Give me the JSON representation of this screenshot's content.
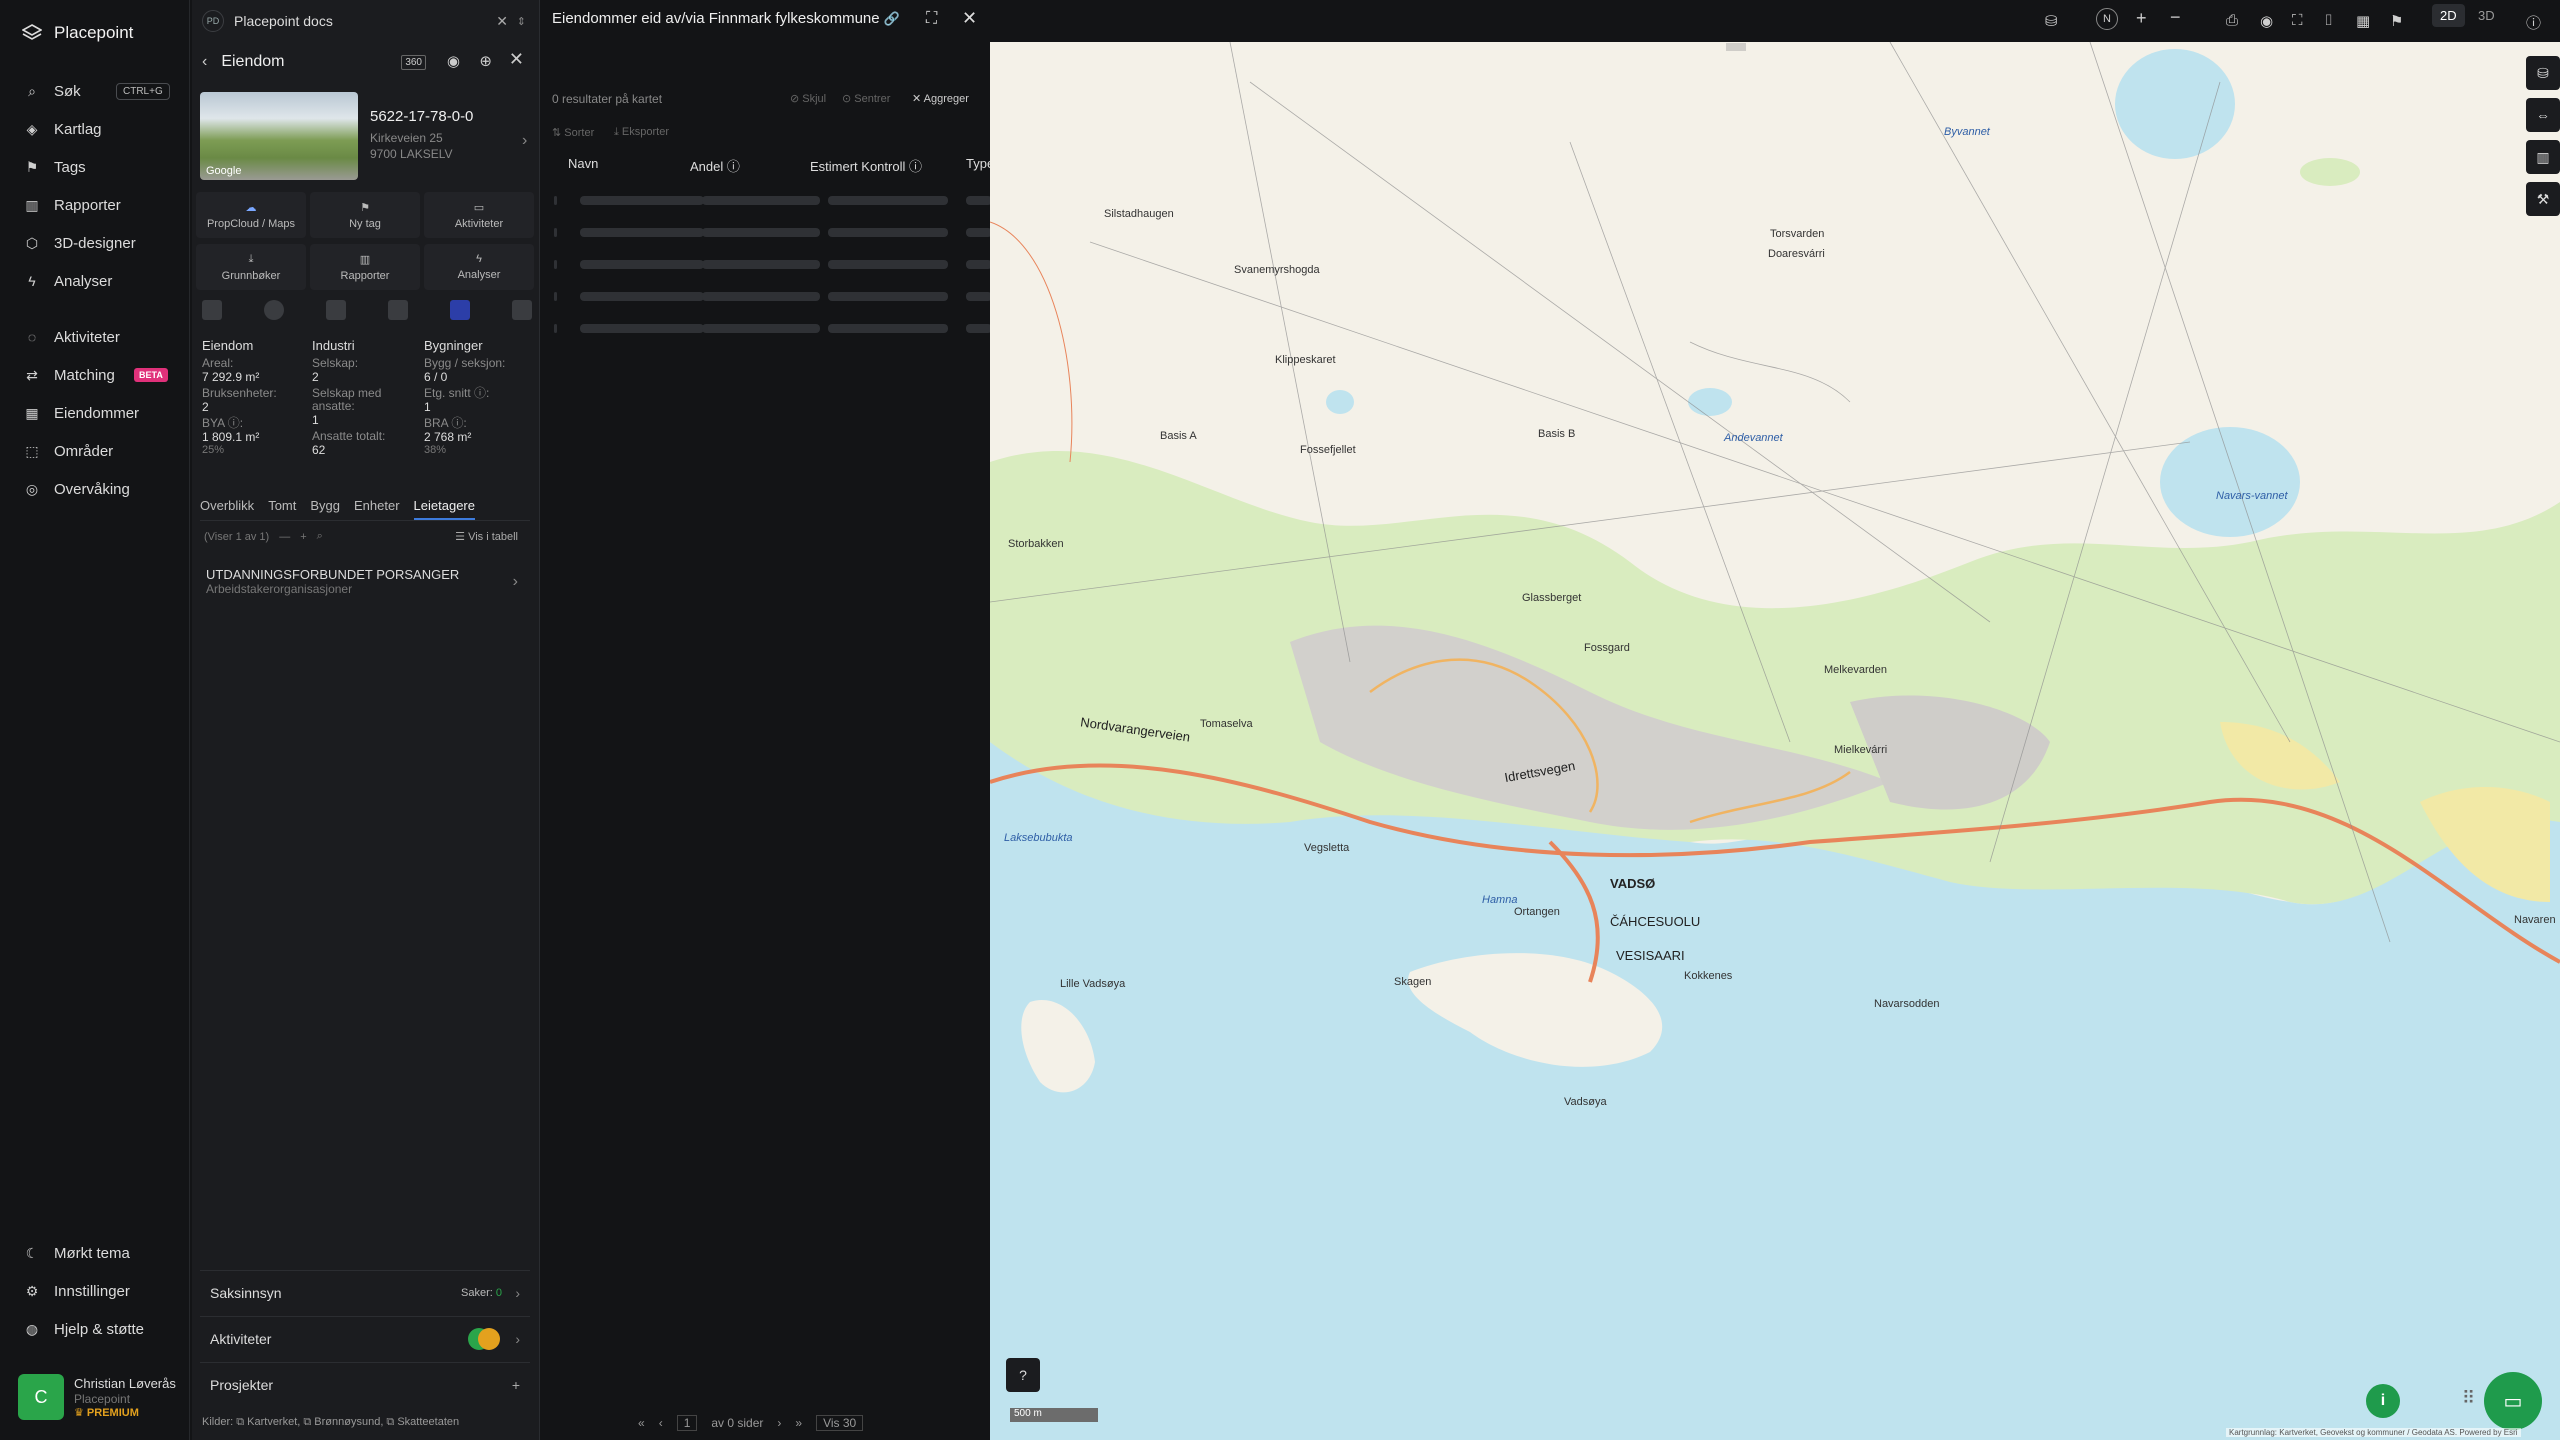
{
  "sidebar": {
    "app_name": "Placepoint",
    "items": [
      {
        "label": "Søk",
        "shortcut": "CTRL+G"
      },
      {
        "label": "Kartlag"
      },
      {
        "label": "Tags"
      },
      {
        "label": "Rapporter"
      },
      {
        "label": "3D-designer"
      },
      {
        "label": "Analyser"
      },
      {
        "label": "Aktiviteter"
      },
      {
        "label": "Matching",
        "badge": "BETA"
      },
      {
        "label": "Eiendommer"
      },
      {
        "label": "Områder"
      },
      {
        "label": "Overvåking"
      }
    ],
    "bottom": [
      {
        "label": "Mørkt tema"
      },
      {
        "label": "Innstillinger"
      },
      {
        "label": "Hjelp & støtte"
      }
    ],
    "user": {
      "initial": "C",
      "name": "Christian Løverås",
      "org": "Placepoint",
      "plan": "PREMIUM"
    }
  },
  "panel": {
    "tab_initials": "PD",
    "tab_title": "Placepoint docs",
    "header_title": "Eiendom",
    "thumb_label": "Google",
    "property_id": "5622-17-78-0-0",
    "address_line1": "Kirkeveien 25",
    "address_line2": "9700 LAKSELV",
    "actions": [
      "PropCloud / Maps",
      "Ny tag",
      "Aktiviteter",
      "Grunnbøker",
      "Rapporter",
      "Analyser"
    ],
    "columns": {
      "eiendom": {
        "title": "Eiendom",
        "areal_label": "Areal:",
        "areal_value": "7 292.9 m²",
        "bruks_label": "Bruksenheter:",
        "bruks_value": "2",
        "bya_label": "BYA ⓘ:",
        "bya_value": "1 809.1 m²",
        "bya_pct": "25%"
      },
      "industri": {
        "title": "Industri",
        "selskap_label": "Selskap:",
        "selskap_value": "2",
        "ansatte_label": "Selskap med ansatte:",
        "ansatte_value": "1",
        "totalt_label": "Ansatte totalt:",
        "totalt_value": "62"
      },
      "bygninger": {
        "title": "Bygninger",
        "bygg_label": "Bygg / seksjon:",
        "bygg_value": "6 / 0",
        "etg_label": "Etg. snitt ⓘ:",
        "etg_value": "1",
        "bra_label": "BRA ⓘ:",
        "bra_value": "2 768 m²",
        "bra_pct": "38%"
      }
    },
    "tabs": [
      "Overblikk",
      "Tomt",
      "Bygg",
      "Enheter",
      "Leietagere"
    ],
    "active_tab": "Leietagere",
    "viser": "(Viser 1 av 1)",
    "vis_tabell": "Vis i tabell",
    "tenant": {
      "name": "UTDANNINGSFORBUNDET PORSANGER",
      "category": "Arbeidstakerorganisasjoner"
    },
    "saksinnsyn": {
      "label": "Saksinnsyn",
      "cases_label": "Saker:",
      "cases_value": "0"
    },
    "aktiviteter_label": "Aktiviteter",
    "prosjekter_label": "Prosjekter",
    "sources": "Kilder: ⧉ Kartverket, ⧉ Brønnøysund, ⧉ Skatteetaten"
  },
  "table": {
    "title": "Eiendommer eid av/via Finnmark fylkeskommune",
    "result_text": "0 resultater på kartet",
    "btn_skjul": "Skjul",
    "btn_sentrer": "Sentrer",
    "btn_aggreger": "Aggreger",
    "btn_sorter": "Sorter",
    "btn_eksporter": "Eksporter",
    "columns": [
      "Navn",
      "Andel ⓘ",
      "Estimert Kontroll ⓘ",
      "Type"
    ],
    "pager": {
      "page": "1",
      "of": "av 0 sider",
      "per_page": "Vis 30"
    }
  },
  "map": {
    "view_2d": "2D",
    "view_3d": "3D",
    "scale": "500 m",
    "attribution": "Kartgrunnlag: Kartverket, Geovekst og kommuner / Geodata AS. Powered by Esri",
    "labels": [
      "Silstadhaugen",
      "Svanemyrshogda",
      "Klippeskaret",
      "Basis A",
      "Fossefjellet",
      "Basis B",
      "Storbakken",
      "Glassberget",
      "Fossgard",
      "Tomaselva",
      "Nordvarangerveien",
      "Laksebubukta",
      "Vegsletta",
      "Idrettsvegen",
      "Hamna",
      "Ortangen",
      "VADSØ",
      "ČÁHCESUOLU",
      "VESISAARI",
      "Skagen",
      "Lille Vadsøya",
      "Kokkenes",
      "Vadsøya",
      "Navaren",
      "Navarsodden",
      "Melkevarden",
      "Mielkevárri",
      "Torsvarden",
      "Doaresvárri",
      "Byvannet",
      "Andevannet",
      "Navars-vannet"
    ]
  }
}
